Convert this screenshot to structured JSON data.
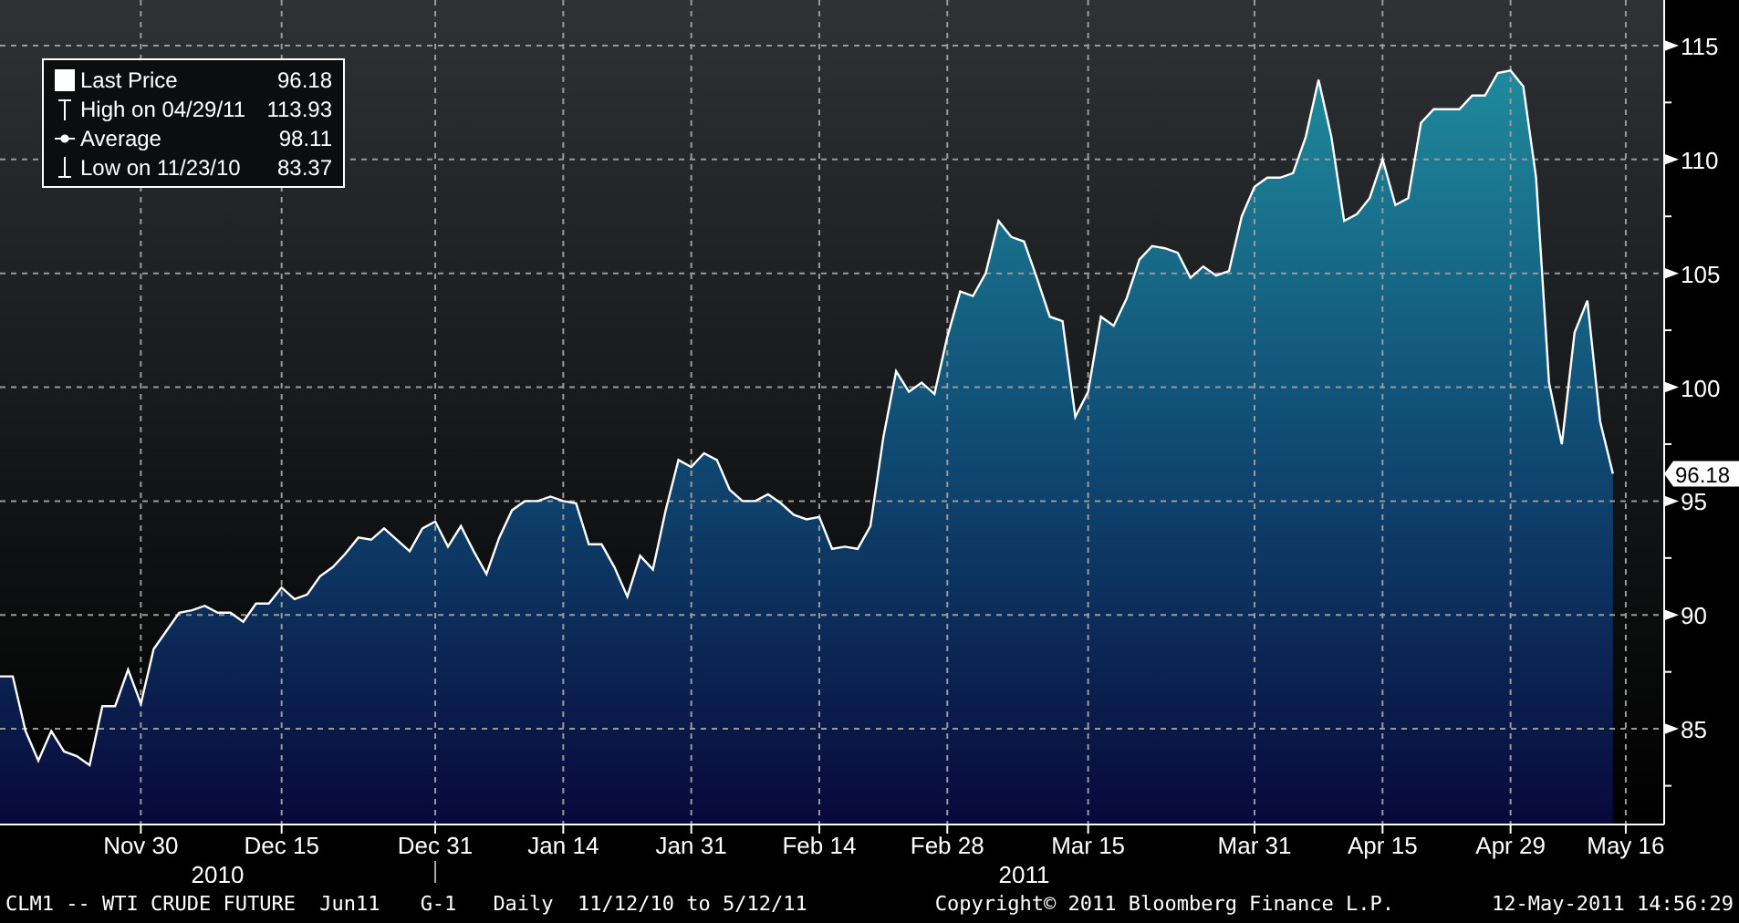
{
  "chart_data": {
    "type": "area",
    "ylim": [
      80.8,
      117
    ],
    "grid": true,
    "categories": [
      null,
      null,
      null,
      null,
      null,
      null,
      null,
      null,
      null,
      null,
      null,
      "Nov 30",
      null,
      null,
      null,
      null,
      null,
      null,
      null,
      null,
      null,
      null,
      "Dec 15",
      null,
      null,
      null,
      null,
      null,
      null,
      null,
      null,
      null,
      null,
      null,
      "Dec 31",
      null,
      null,
      null,
      null,
      null,
      null,
      null,
      null,
      null,
      "Jan 14",
      null,
      null,
      null,
      null,
      null,
      null,
      null,
      null,
      null,
      "Jan 31",
      null,
      null,
      null,
      null,
      null,
      null,
      null,
      null,
      null,
      "Feb 14",
      null,
      null,
      null,
      null,
      null,
      null,
      null,
      null,
      null,
      "Feb 28",
      null,
      null,
      null,
      null,
      null,
      null,
      null,
      null,
      null,
      null,
      "Mar 15",
      null,
      null,
      null,
      null,
      null,
      null,
      null,
      null,
      null,
      null,
      null,
      null,
      "Mar 31",
      null,
      null,
      null,
      null,
      null,
      null,
      null,
      null,
      null,
      "Apr 15",
      null,
      null,
      null,
      null,
      null,
      null,
      null,
      null,
      null,
      "Apr 29",
      null,
      null,
      null,
      null,
      null,
      null,
      null,
      null,
      "May 16"
    ],
    "series": [
      {
        "name": "Last Price",
        "color": "#ffffff",
        "values": [
          87.3,
          87.3,
          84.9,
          83.6,
          84.9,
          84.0,
          83.8,
          83.4,
          86.0,
          86.0,
          87.6,
          86.1,
          88.5,
          89.3,
          90.1,
          90.2,
          90.4,
          90.1,
          90.1,
          89.7,
          90.5,
          90.5,
          91.2,
          90.7,
          90.9,
          91.7,
          92.1,
          92.7,
          93.4,
          93.3,
          93.8,
          93.3,
          92.8,
          93.8,
          94.1,
          93.0,
          93.9,
          92.8,
          91.8,
          93.4,
          94.6,
          95.0,
          95.0,
          95.2,
          95.0,
          94.9,
          93.1,
          93.1,
          92.1,
          90.8,
          92.6,
          92.0,
          94.6,
          96.8,
          96.5,
          97.1,
          96.8,
          95.5,
          95.0,
          95.0,
          95.3,
          94.9,
          94.4,
          94.2,
          94.3,
          92.9,
          93.0,
          92.9,
          93.9,
          97.8,
          100.7,
          99.8,
          100.2,
          99.7,
          102.2,
          104.2,
          104.0,
          105.0,
          107.3,
          106.6,
          106.4,
          104.8,
          103.1,
          102.9,
          98.7,
          99.8,
          103.1,
          102.7,
          103.9,
          105.6,
          106.2,
          106.1,
          105.9,
          104.8,
          105.3,
          104.9,
          105.1,
          107.5,
          108.8,
          109.2,
          109.2,
          109.4,
          111.0,
          113.5,
          111.0,
          107.3,
          107.6,
          108.3,
          110.0,
          108.0,
          108.3,
          111.6,
          112.2,
          112.2,
          112.2,
          112.8,
          112.8,
          113.8,
          113.9,
          113.2,
          109.2,
          100.2,
          97.5,
          102.4,
          103.8,
          98.5,
          96.2,
          null
        ]
      }
    ],
    "yticks": [
      85,
      90,
      95,
      100,
      105,
      110,
      115
    ],
    "annotations": [
      "96.18"
    ]
  },
  "years": [
    {
      "label": "2010"
    },
    {
      "label": "2011"
    }
  ],
  "legend": [
    {
      "kind": "box",
      "value": "96.18"
    },
    {
      "kind": "high",
      "label": "High on 04/29/11",
      "value": "113.93"
    },
    {
      "kind": "average",
      "label": "Average",
      "value": "98.11"
    },
    {
      "kind": "low",
      "label": "Low on 11/23/10",
      "value": "83.37"
    }
  ],
  "footer": {
    "ticker": "CLM1 -- WTI CRUDE FUTURE  Jun11",
    "graph": "G-1",
    "range": "Daily  11/12/10 to 5/12/11",
    "copyright": "Copyright© 2011 Bloomberg Finance L.P.",
    "timestamp": "12-May-2011 14:56:29"
  }
}
